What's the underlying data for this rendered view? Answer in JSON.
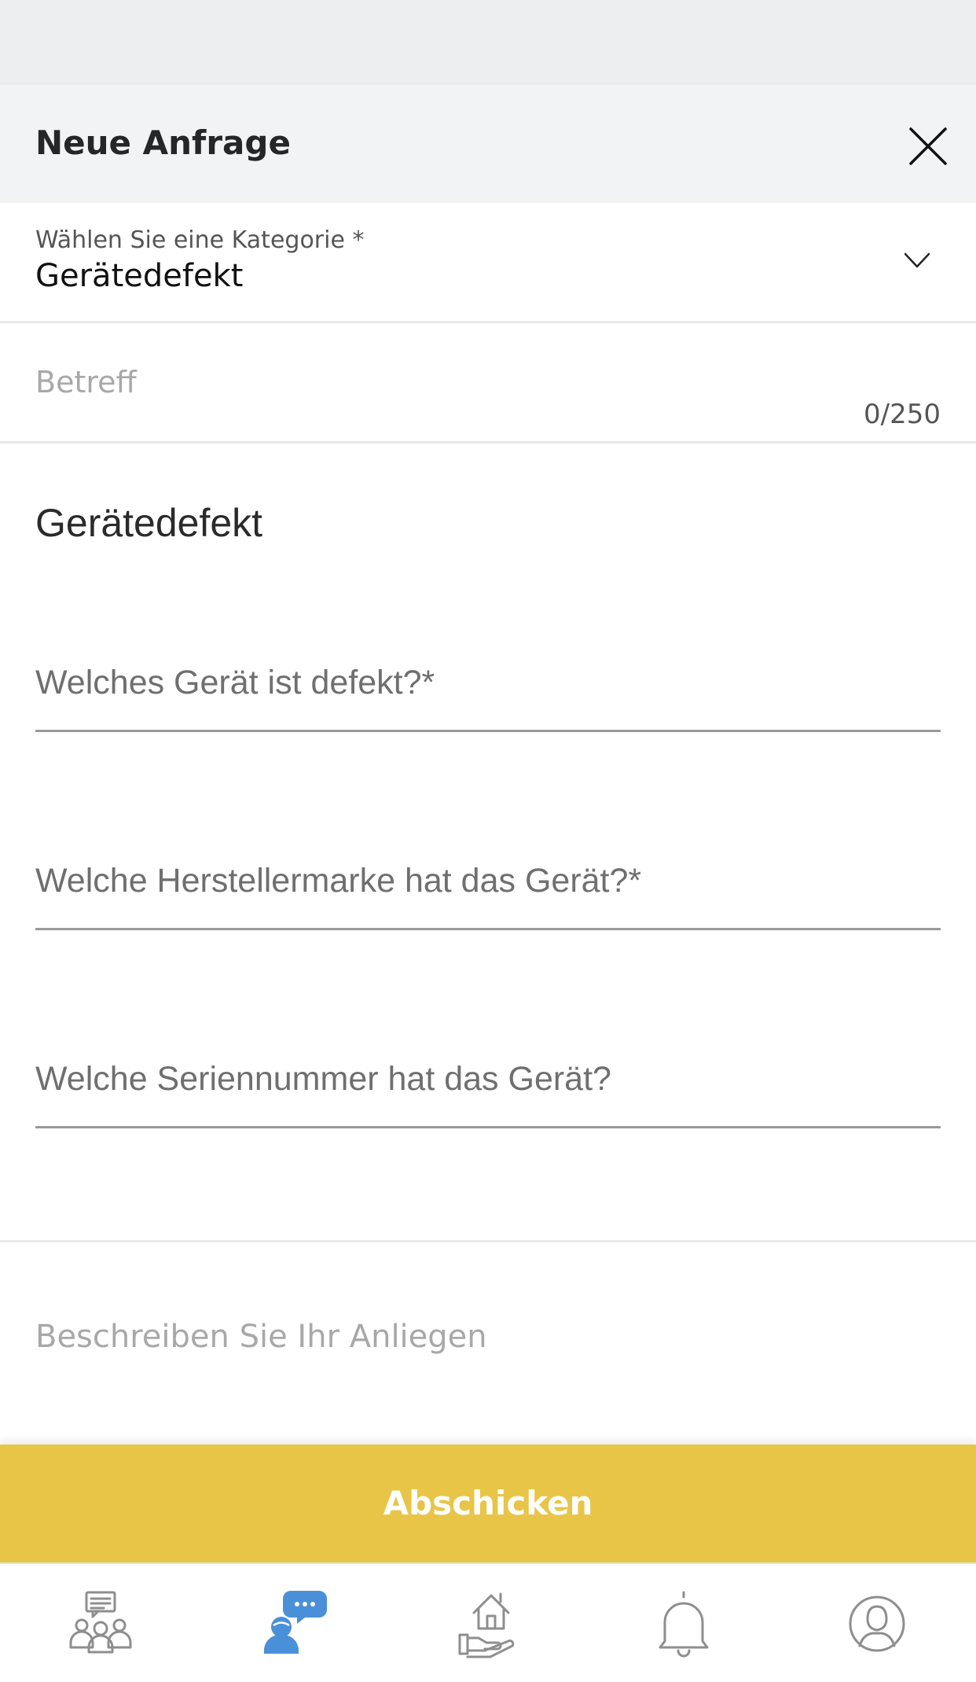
{
  "header": {
    "title": "Neue Anfrage"
  },
  "category": {
    "label": "Wählen Sie eine Kategorie *",
    "value": "Gerätedefekt"
  },
  "subject": {
    "placeholder": "Betreff",
    "value": "",
    "counter": "0/250"
  },
  "form_section": {
    "title": "Gerätedefekt",
    "fields": [
      {
        "placeholder": "Welches Gerät ist defekt?*",
        "value": ""
      },
      {
        "placeholder": "Welche Herstellermarke hat das Gerät?*",
        "value": ""
      },
      {
        "placeholder": "Welche Seriennummer hat das Gerät?",
        "value": ""
      }
    ]
  },
  "description": {
    "placeholder": "Beschreiben Sie Ihr Anliegen",
    "value": ""
  },
  "submit": {
    "label": "Abschicken"
  },
  "tabbar": {
    "items": [
      {
        "icon": "community-icon",
        "active": false
      },
      {
        "icon": "chat-support-icon",
        "active": true
      },
      {
        "icon": "home-hand-icon",
        "active": false
      },
      {
        "icon": "bell-icon",
        "active": false
      },
      {
        "icon": "profile-icon",
        "active": false
      }
    ]
  },
  "colors": {
    "accent": "#e8c547",
    "tab_active": "#4a90d9",
    "tab_inactive": "#8e8e8e",
    "header_bg": "#f2f3f4"
  }
}
